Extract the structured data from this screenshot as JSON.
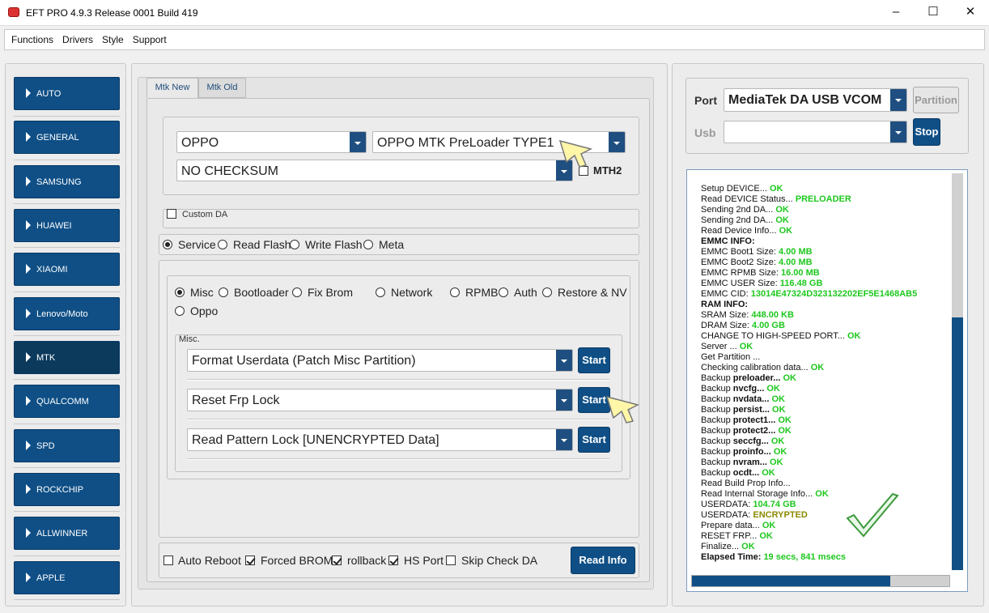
{
  "window": {
    "title": "EFT PRO 4.9.3 Release 0001 Build 419"
  },
  "menu": [
    "Functions",
    "Drivers",
    "Style",
    "Support"
  ],
  "sidebar": [
    "AUTO",
    "GENERAL",
    "SAMSUNG",
    "HUAWEI",
    "XIAOMI",
    "Lenovo/Moto",
    "MTK",
    "QUALCOMM",
    "SPD",
    "ROCKCHIP",
    "ALLWINNER",
    "APPLE"
  ],
  "tabs": [
    "Mtk New",
    "Mtk Old"
  ],
  "device": {
    "brand": "OPPO",
    "model": "OPPO MTK PreLoader TYPE1",
    "checksum": "NO CHECKSUM",
    "mth2": "MTH2",
    "custom_da": "Custom DA"
  },
  "modes": [
    "Service",
    "Read Flash",
    "Write Flash",
    "Meta"
  ],
  "subtabs": [
    "Misc",
    "Bootloader",
    "Fix Brom",
    "Network",
    "RPMB",
    "Auth",
    "Restore & NV",
    "Oppo"
  ],
  "misc": {
    "label": "Misc.",
    "ops": [
      {
        "value": "Format Userdata (Patch Misc Partition)",
        "button": "Start"
      },
      {
        "value": "Reset Frp Lock",
        "button": "Start"
      },
      {
        "value": "Read Pattern Lock [UNENCRYPTED Data]",
        "button": "Start"
      }
    ]
  },
  "options": [
    {
      "label": "Auto Reboot",
      "checked": false
    },
    {
      "label": "Forced BROM",
      "checked": true
    },
    {
      "label": "rollback",
      "checked": true
    },
    {
      "label": "HS Port",
      "checked": true
    },
    {
      "label": "Skip Check DA",
      "checked": false
    }
  ],
  "read_info": "Read Info",
  "port": {
    "label": "Port",
    "value": "MediaTek DA USB VCOM",
    "partition": "Partition",
    "usb_label": "Usb",
    "usb_value": "",
    "stop": "Stop"
  },
  "log": [
    {
      "t": "Setup DEVICE... ",
      "v": "OK",
      "c": "ok"
    },
    {
      "t": "Read DEVICE Status... ",
      "v": "PRELOADER",
      "c": "ok"
    },
    {
      "t": "Sending 2nd DA... ",
      "v": "OK",
      "c": "ok"
    },
    {
      "t": "Sending 2nd DA... ",
      "v": "OK",
      "c": "ok"
    },
    {
      "t": "Read Device Info... ",
      "v": "OK",
      "c": "ok"
    },
    {
      "t": "EMMC INFO:",
      "v": "",
      "c": "b"
    },
    {
      "t": "EMMC Boot1 Size: ",
      "v": "4.00 MB",
      "c": "ok"
    },
    {
      "t": "EMMC Boot2 Size: ",
      "v": "4.00 MB",
      "c": "ok"
    },
    {
      "t": "EMMC RPMB Size: ",
      "v": "16.00 MB",
      "c": "ok"
    },
    {
      "t": "EMMC USER Size: ",
      "v": "116.48 GB",
      "c": "ok"
    },
    {
      "t": "EMMC CID: ",
      "v": "13014E47324D323132202EF5E1468AB5",
      "c": "ok"
    },
    {
      "t": "RAM INFO:",
      "v": "",
      "c": "b"
    },
    {
      "t": "SRAM Size: ",
      "v": "448.00 KB",
      "c": "ok"
    },
    {
      "t": "DRAM Size: ",
      "v": "4.00 GB",
      "c": "ok"
    },
    {
      "t": "CHANGE TO HIGH-SPEED PORT... ",
      "v": "OK",
      "c": "ok"
    },
    {
      "t": "Server ... ",
      "v": "OK",
      "c": "ok"
    },
    {
      "t": "Get Partition ...",
      "v": "",
      "c": ""
    },
    {
      "t": "Checking calibration data... ",
      "v": "OK",
      "c": "ok"
    },
    {
      "t": " Backup ",
      "p": "preloader",
      "v": "OK",
      "c": "ok"
    },
    {
      "t": " Backup ",
      "p": "nvcfg",
      "v": "OK",
      "c": "ok"
    },
    {
      "t": " Backup ",
      "p": "nvdata",
      "v": "OK",
      "c": "ok"
    },
    {
      "t": " Backup ",
      "p": "persist",
      "v": "OK",
      "c": "ok"
    },
    {
      "t": " Backup ",
      "p": "protect1",
      "v": "OK",
      "c": "ok"
    },
    {
      "t": " Backup ",
      "p": "protect2",
      "v": "OK",
      "c": "ok"
    },
    {
      "t": " Backup ",
      "p": "seccfg",
      "v": "OK",
      "c": "ok"
    },
    {
      "t": " Backup ",
      "p": "proinfo",
      "v": "OK",
      "c": "ok"
    },
    {
      "t": " Backup ",
      "p": "nvram",
      "v": "OK",
      "c": "ok"
    },
    {
      "t": " Backup ",
      "p": "ocdt",
      "v": "OK",
      "c": "ok"
    },
    {
      "t": "Read Build Prop Info...",
      "v": "",
      "c": ""
    },
    {
      "t": "Read Internal Storage Info... ",
      "v": "OK",
      "c": "ok"
    },
    {
      "t": "USERDATA: ",
      "v": "104.74 GB",
      "c": "ok"
    },
    {
      "t": "USERDATA: ",
      "v": "ENCRYPTED",
      "c": "oliv"
    },
    {
      "t": "Prepare data... ",
      "v": "OK",
      "c": "ok"
    },
    {
      "t": "RESET FRP... ",
      "v": "OK",
      "c": "ok"
    },
    {
      "t": "Finalize... ",
      "v": "OK",
      "c": "ok"
    },
    {
      "t": "Elapsed Time: ",
      "v": "19 secs, 841 msecs",
      "c": "ok",
      "bold": true
    }
  ],
  "progress": 0.77,
  "colors": {
    "accent": "#0f4f86",
    "ok": "#1ec81e"
  }
}
